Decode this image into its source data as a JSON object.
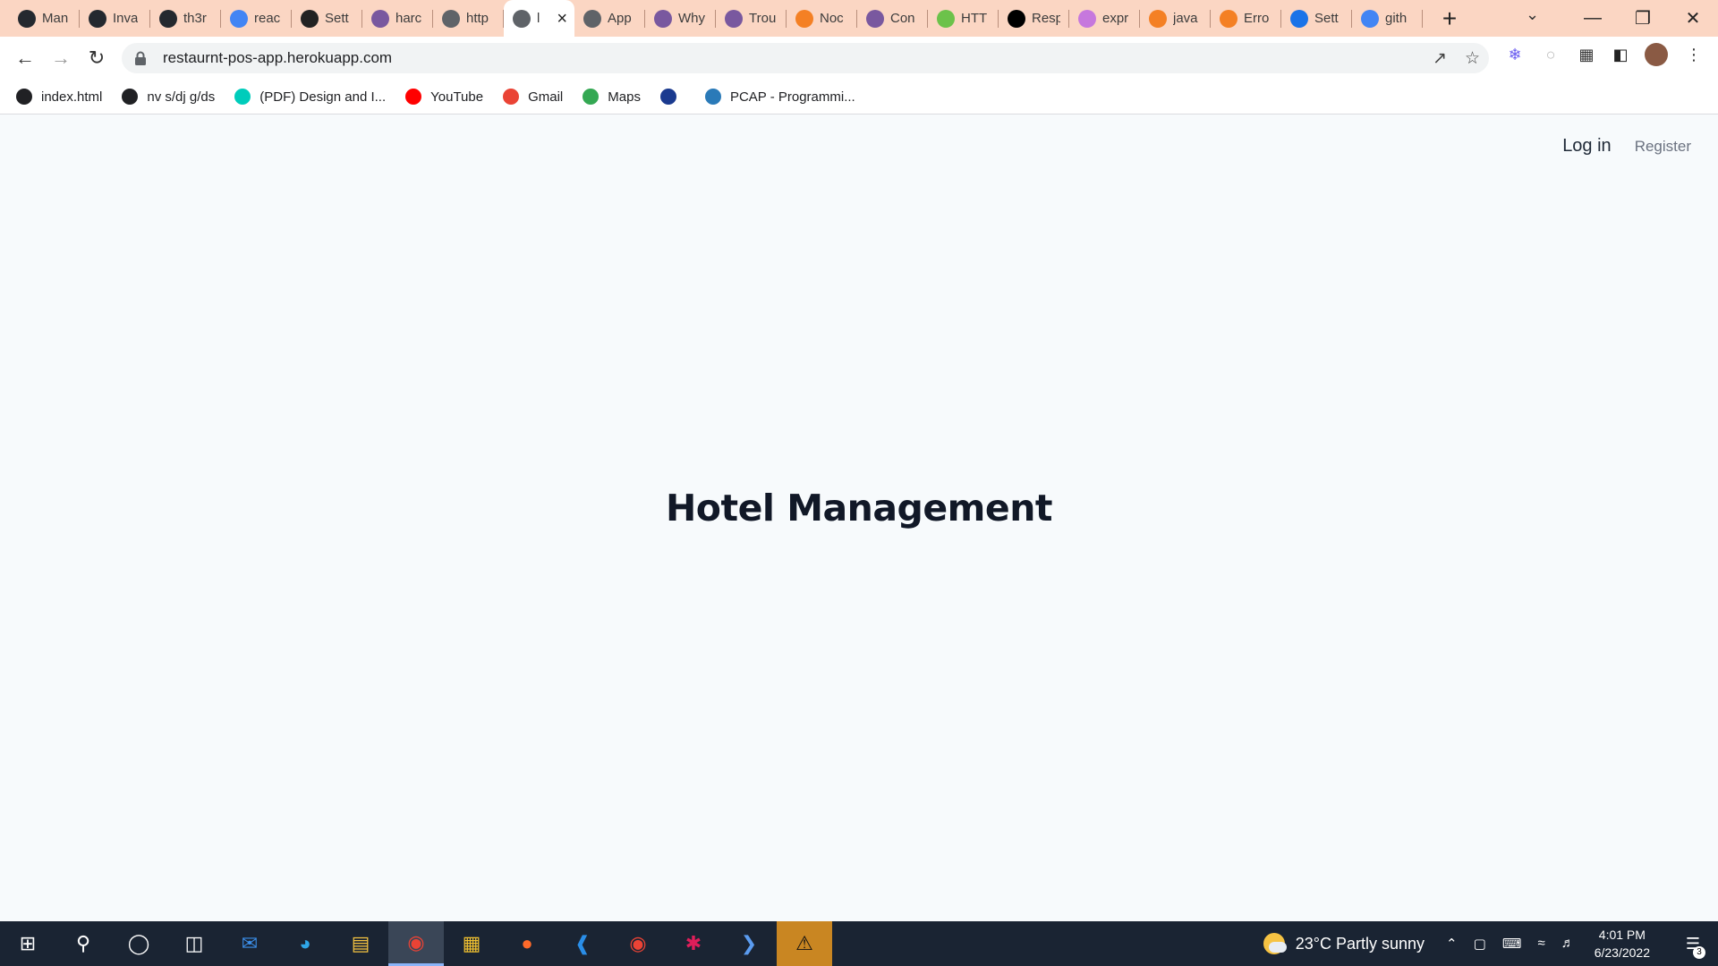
{
  "browser": {
    "tabs": [
      {
        "title": "Man",
        "icon": "github-icon",
        "color": "#24292f"
      },
      {
        "title": "Inva",
        "icon": "github-icon",
        "color": "#24292f"
      },
      {
        "title": "th3r",
        "icon": "github-icon",
        "color": "#24292f"
      },
      {
        "title": "reac",
        "icon": "google-icon",
        "color": "#4285f4"
      },
      {
        "title": "Sett",
        "icon": "react-icon",
        "color": "#222222"
      },
      {
        "title": "harc",
        "icon": "heroku-icon",
        "color": "#79589f"
      },
      {
        "title": "http",
        "icon": "globe-icon",
        "color": "#5f6368"
      },
      {
        "title": "l",
        "icon": "globe-icon",
        "color": "#5f6368",
        "active": true
      },
      {
        "title": "App",
        "icon": "globe-icon",
        "color": "#5f6368"
      },
      {
        "title": "Why",
        "icon": "heroku-icon",
        "color": "#79589f"
      },
      {
        "title": "Trou",
        "icon": "heroku-icon",
        "color": "#79589f"
      },
      {
        "title": "Noc",
        "icon": "stackoverflow-icon",
        "color": "#f48024"
      },
      {
        "title": "Con",
        "icon": "heroku-icon",
        "color": "#79589f"
      },
      {
        "title": "HTT",
        "icon": "node-icon",
        "color": "#6cc24a"
      },
      {
        "title": "Resp",
        "icon": "medium-icon",
        "color": "#000000"
      },
      {
        "title": "expr",
        "icon": "graphql-icon",
        "color": "#c678dd"
      },
      {
        "title": "java",
        "icon": "stackoverflow-icon",
        "color": "#f48024"
      },
      {
        "title": "Erro",
        "icon": "stackoverflow-icon",
        "color": "#f48024"
      },
      {
        "title": "Sett",
        "icon": "gear-icon",
        "color": "#1a73e8"
      },
      {
        "title": "gith",
        "icon": "google-icon",
        "color": "#4285f4"
      }
    ],
    "url": "restaurnt-pos-app.herokuapp.com",
    "bookmarks": [
      {
        "label": "index.html",
        "icon": "globe-icon",
        "color": "#202124"
      },
      {
        "label": "nv s/dj g/ds",
        "icon": "globe-icon",
        "color": "#202124"
      },
      {
        "label": "(PDF) Design and I...",
        "icon": "researchgate-icon",
        "color": "#00ccbb"
      },
      {
        "label": "YouTube",
        "icon": "youtube-icon",
        "color": "#ff0000"
      },
      {
        "label": "Gmail",
        "icon": "gmail-icon",
        "color": "#ea4335"
      },
      {
        "label": "Maps",
        "icon": "maps-icon",
        "color": "#34a853"
      },
      {
        "label": "",
        "icon": "bookmark-app-icon",
        "color": "#1a3a8f"
      },
      {
        "label": "PCAP - Programmi...",
        "icon": "pcap-icon",
        "color": "#2a7ab8"
      }
    ]
  },
  "page": {
    "nav": {
      "login": "Log in",
      "register": "Register"
    },
    "heading": "Hotel Management"
  },
  "taskbar": {
    "weather": "23°C  Partly sunny",
    "time": "4:01 PM",
    "date": "6/23/2022",
    "notifications": "3"
  }
}
